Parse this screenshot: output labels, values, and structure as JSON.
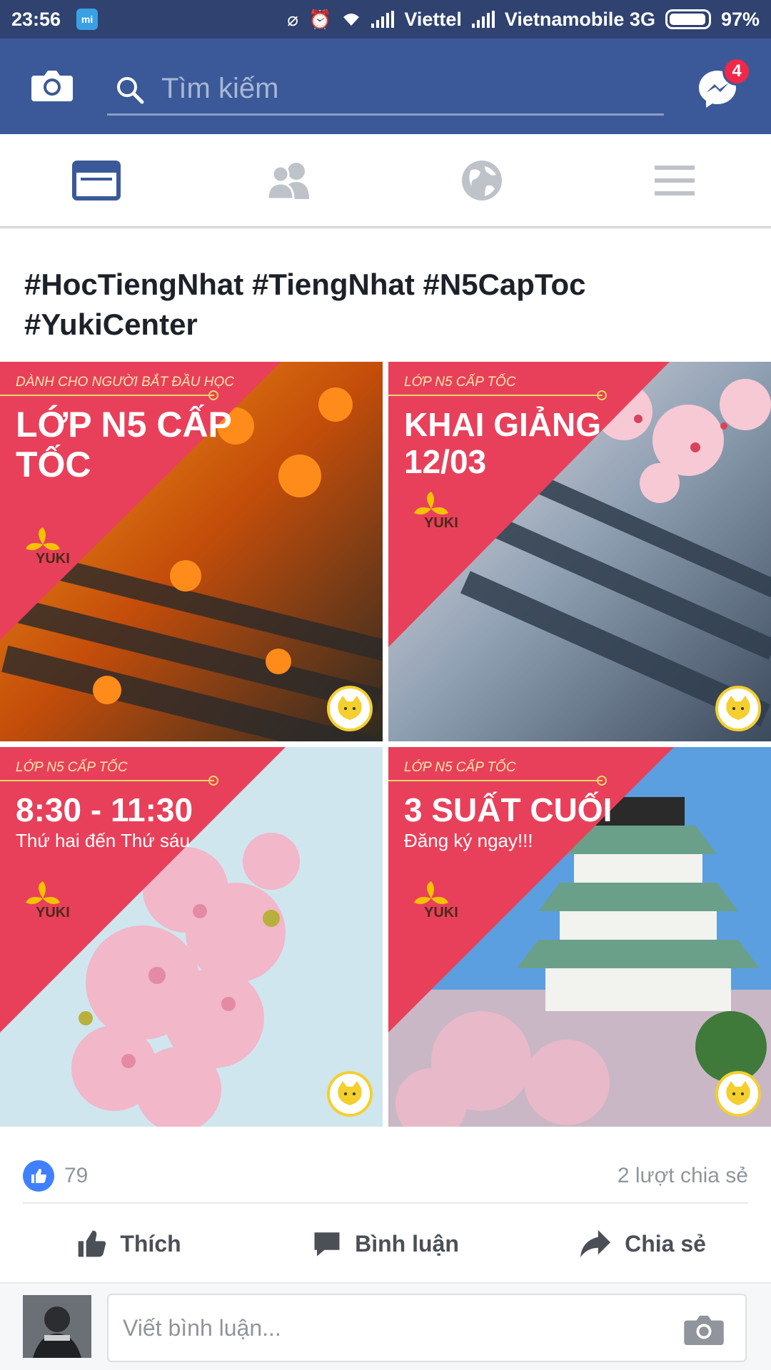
{
  "status_bar": {
    "time": "23:56",
    "carrier1": "Viettel",
    "carrier2": "Vietnamobile 3G",
    "battery": "97%",
    "battery_level": 0.97
  },
  "header": {
    "search_placeholder": "Tìm kiếm",
    "messenger_badge": "4",
    "icons": [
      "camera-icon",
      "search-icon",
      "messenger-icon"
    ]
  },
  "nav_tabs": [
    {
      "name": "news-feed",
      "icon": "news-feed-icon",
      "active": true
    },
    {
      "name": "friends",
      "icon": "friends-icon",
      "active": false
    },
    {
      "name": "notifications",
      "icon": "globe-icon",
      "active": false
    },
    {
      "name": "menu",
      "icon": "menu-icon",
      "active": false
    }
  ],
  "post": {
    "text": "#HocTiengNhat #TiengNhat #N5CapToc #YukiCenter",
    "tiles": [
      {
        "kicker": "DÀNH CHO NGƯỜI BẮT ĐẦU HỌC",
        "headline": "LỚP N5 CẤP TỐC",
        "sub": "",
        "logo": "YUKI",
        "theme": "autumn"
      },
      {
        "kicker": "LỚP N5 CẤP TỐC",
        "headline": "KHAI GIẢNG 12/03",
        "sub": "",
        "logo": "YUKI",
        "theme": "roof"
      },
      {
        "kicker": "LỚP N5 CẤP TỐC",
        "headline": "8:30 - 11:30",
        "sub": "Thứ hai đến Thứ sáu",
        "logo": "YUKI",
        "theme": "sakura"
      },
      {
        "kicker": "LỚP N5 CẤP TỐC",
        "headline": "3 SUẤT CUỐI",
        "sub": "Đăng ký ngay!!!",
        "logo": "YUKI",
        "theme": "castle"
      }
    ],
    "likes": "79",
    "shares": "2 lượt chia sẻ",
    "actions": {
      "like": "Thích",
      "comment": "Bình luận",
      "share": "Chia sẻ"
    },
    "comment_placeholder": "Viết bình luận..."
  },
  "colors": {
    "status_bar": "#2f4270",
    "header": "#3b5998",
    "tile_red": "#e8405a",
    "like_blue": "#4080ff",
    "badge_red": "#f02849"
  }
}
